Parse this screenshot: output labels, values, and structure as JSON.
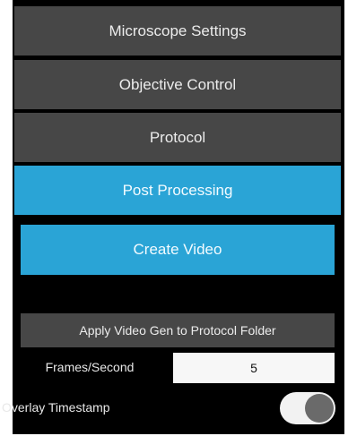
{
  "menu": {
    "items": [
      {
        "label": "Microscope Settings",
        "active": false
      },
      {
        "label": "Objective Control",
        "active": false
      },
      {
        "label": "Protocol",
        "active": false
      },
      {
        "label": "Post Processing",
        "active": true
      }
    ]
  },
  "post_processing": {
    "create_video_label": "Create Video",
    "apply_folder_label": "Apply Video Gen to Protocol Folder",
    "fps_label": "Frames/Second",
    "fps_value": "5",
    "overlay_label": "Overlay Timestamp",
    "overlay_enabled": true
  },
  "colors": {
    "panel_bg": "#000000",
    "button_bg": "#474747",
    "accent": "#2aa4d6",
    "input_bg": "#f7f7f7",
    "toggle_track": "#f2f2f2",
    "toggle_knob": "#6a6a6a"
  }
}
